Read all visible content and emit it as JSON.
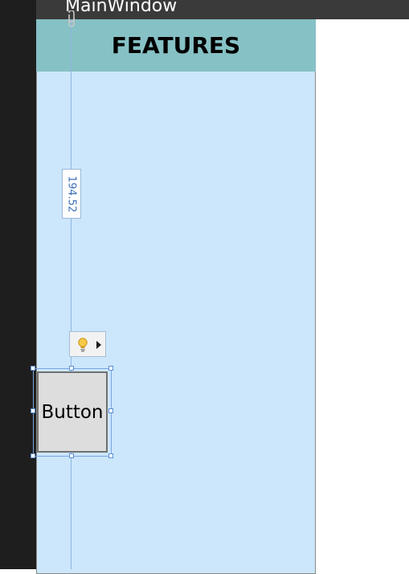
{
  "window": {
    "title": "MainWindow"
  },
  "header": {
    "title": "FEATURES"
  },
  "designer": {
    "measurement_label": "194.52",
    "selected_element_label": "Button",
    "actions_icon": "lightbulb-icon"
  },
  "colors": {
    "header_band": "#86c1c5",
    "canvas_background": "#cce6fb",
    "guide_line": "#8fb6df",
    "editor_left_panel": "#1e1e1e",
    "title_bar": "#3a3a3a",
    "button_face": "#dddddd"
  }
}
